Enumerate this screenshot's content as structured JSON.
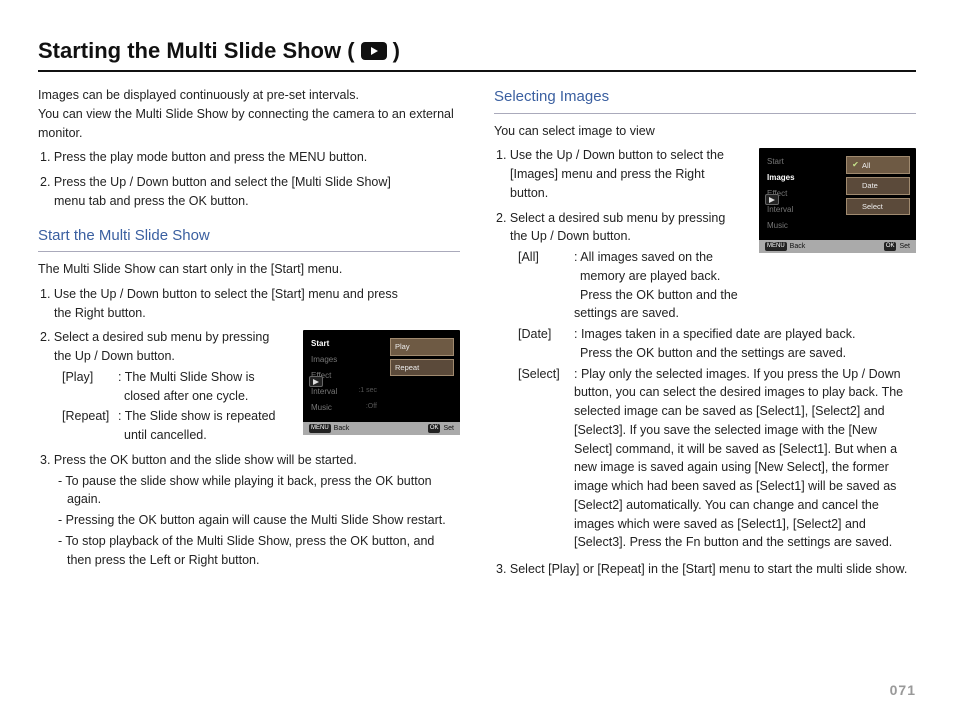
{
  "title_left": "Starting the Multi Slide Show (",
  "title_right": ")",
  "intro_p1": "Images can be displayed continuously at pre-set intervals.",
  "intro_p2": "You can view the Multi Slide Show by connecting the camera to an external monitor.",
  "intro_step1": "1. Press the play mode button and press the MENU button.",
  "intro_step2_a": "2. Press the Up / Down button and select the [Multi Slide Show]",
  "intro_step2_b": "menu tab and press the OK button.",
  "sub1": "Start the Multi Slide Show",
  "sub1_intro": "The Multi Slide Show can start only in the [Start] menu.",
  "sub1_s1_a": "1. Use the Up / Down button to select the [Start] menu and press",
  "sub1_s1_b": "the Right button.",
  "sub1_s2_a": "2. Select a desired sub menu by pressing",
  "sub1_s2_b": "the Up / Down button.",
  "sub1_play_lbl": "[Play]",
  "sub1_play_txt_a": ": The Multi Slide Show is",
  "sub1_play_txt_b": "closed after one cycle.",
  "sub1_repeat_lbl": "[Repeat]",
  "sub1_repeat_txt_a": ": The Slide show is repeated",
  "sub1_repeat_txt_b": "until cancelled.",
  "sub1_s3": "3. Press the OK button and the slide show will be started.",
  "sub1_b1": "To pause the slide show while playing it back, press the OK button again.",
  "sub1_b2": "Pressing the OK button again will cause the Multi Slide Show restart.",
  "sub1_b3": "To stop playback of the Multi Slide Show, press the OK button, and then press the Left or Right button.",
  "sub2": "Selecting Images",
  "sub2_intro": "You can select image to view",
  "sub2_s1_a": "1. Use the Up / Down button to select the",
  "sub2_s1_b": "[Images] menu and press the Right",
  "sub2_s1_c": "button.",
  "sub2_s2_a": "2. Select a desired sub menu by pressing",
  "sub2_s2_b": "the Up / Down button.",
  "sub2_all_lbl": "[All]",
  "sub2_all_txt_a": ": All images saved on the",
  "sub2_all_txt_b": "memory are played back.",
  "sub2_all_txt_c": "Press the OK button and the settings are saved.",
  "sub2_date_lbl": "[Date]",
  "sub2_date_txt_a": ": Images taken in a specified date are played back.",
  "sub2_date_txt_b": "Press the OK button and the settings are saved.",
  "sub2_select_lbl": "[Select]",
  "sub2_select_txt": ": Play only the selected images. If you press the Up / Down button, you can select the desired images to play back. The selected image can be saved as [Select1], [Select2] and [Select3]. If you save the selected image with the [New Select] command, it will be saved as [Select1]. But when a new image is saved again using [New Select], the former image which had been saved as [Select1] will be saved as [Select2] automatically. You can change and cancel the images which were saved as [Select1], [Select2] and [Select3]. Press the Fn button and the settings are saved.",
  "sub2_s3": "3. Select [Play] or [Repeat] in the [Start] menu to start the multi slide show.",
  "lcd1": {
    "menu": [
      "Start",
      "Images",
      "Effect",
      "Interval",
      "Music"
    ],
    "active": "Start",
    "interval_val": ":1 sec",
    "music_val": ":Off",
    "right": [
      "Play",
      "Repeat"
    ],
    "back": "Back",
    "set": "Set",
    "menu_key": "MENU",
    "ok_key": "OK"
  },
  "lcd2": {
    "menu": [
      "Start",
      "Images",
      "Effect",
      "Interval",
      "Music"
    ],
    "active": "Images",
    "right": [
      {
        "label": "All",
        "checked": true
      },
      {
        "label": "Date",
        "checked": false
      },
      {
        "label": "Select",
        "checked": false
      }
    ],
    "back": "Back",
    "set": "Set",
    "menu_key": "MENU",
    "ok_key": "OK"
  },
  "page_number": "071"
}
